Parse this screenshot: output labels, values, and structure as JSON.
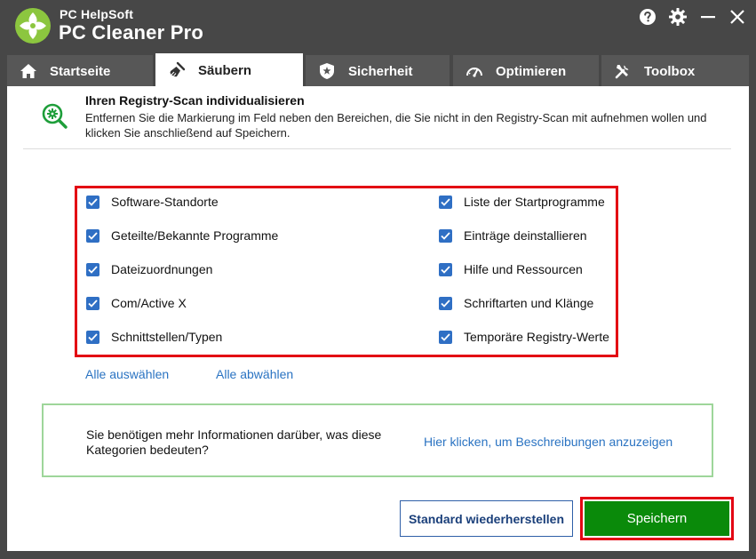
{
  "app": {
    "vendor": "PC HelpSoft",
    "name": "PC Cleaner Pro"
  },
  "tabs": [
    {
      "label": "Startseite",
      "icon": "home-icon",
      "active": false
    },
    {
      "label": "Säubern",
      "icon": "broom-icon",
      "active": true
    },
    {
      "label": "Sicherheit",
      "icon": "shield-icon",
      "active": false
    },
    {
      "label": "Optimieren",
      "icon": "gauge-icon",
      "active": false
    },
    {
      "label": "Toolbox",
      "icon": "tools-icon",
      "active": false
    }
  ],
  "header": {
    "title": "Ihren Registry-Scan individualisieren",
    "description": "Entfernen Sie die Markierung im Feld neben den Bereichen, die Sie nicht in den Registry-Scan mit aufnehmen wollen und klicken Sie anschließend auf Speichern."
  },
  "categories": {
    "left": [
      {
        "label": "Software-Standorte",
        "checked": true
      },
      {
        "label": "Geteilte/Bekannte Programme",
        "checked": true
      },
      {
        "label": "Dateizuordnungen",
        "checked": true
      },
      {
        "label": "Com/Active X",
        "checked": true
      },
      {
        "label": "Schnittstellen/Typen",
        "checked": true
      }
    ],
    "right": [
      {
        "label": "Liste der Startprogramme",
        "checked": true
      },
      {
        "label": "Einträge deinstallieren",
        "checked": true
      },
      {
        "label": "Hilfe und Ressourcen",
        "checked": true
      },
      {
        "label": "Schriftarten und Klänge",
        "checked": true
      },
      {
        "label": "Temporäre Registry-Werte",
        "checked": true
      }
    ]
  },
  "selection": {
    "select_all": "Alle auswählen",
    "deselect_all": "Alle abwählen"
  },
  "info": {
    "text": "Sie benötigen mehr Informationen darüber, was diese Kategorien bedeuten?",
    "link": "Hier klicken, um Beschreibungen anzuzeigen"
  },
  "buttons": {
    "restore_default": "Standard wiederherstellen",
    "save": "Speichern"
  },
  "colors": {
    "accent_green": "#0a8a0a",
    "highlight_red": "#e30613",
    "link_blue": "#2a73c2",
    "checkbox_blue": "#2f6fc4"
  }
}
